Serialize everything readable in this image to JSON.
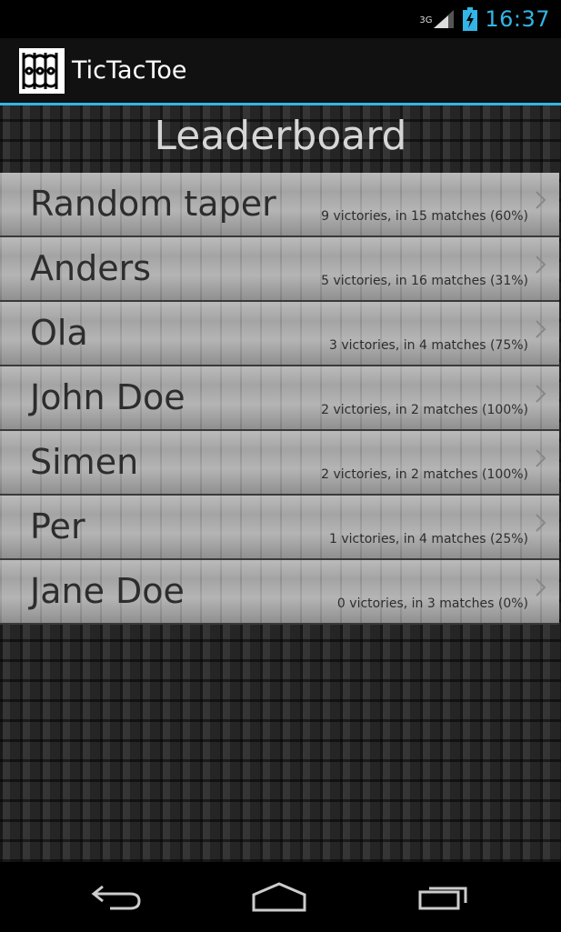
{
  "status_bar": {
    "network": "3G",
    "time": "16:37",
    "icons": [
      "signal-icon",
      "battery-charging-icon"
    ]
  },
  "action_bar": {
    "app_title": "TicTacToe",
    "app_icon": "app-logo-icon"
  },
  "screen": {
    "title": "Leaderboard"
  },
  "leaderboard": {
    "entries": [
      {
        "name": "Random taper",
        "stats": "9 victories, in 15 matches (60%)"
      },
      {
        "name": "Anders",
        "stats": "5 victories, in 16 matches (31%)"
      },
      {
        "name": "Ola",
        "stats": "3 victories, in 4 matches (75%)"
      },
      {
        "name": "John Doe",
        "stats": "2 victories, in 2 matches (100%)"
      },
      {
        "name": "Simen",
        "stats": "2 victories, in 2 matches (100%)"
      },
      {
        "name": "Per",
        "stats": "1 victories, in 4 matches (25%)"
      },
      {
        "name": "Jane Doe",
        "stats": "0 victories, in 3 matches (0%)"
      }
    ]
  },
  "nav_bar": {
    "icons": [
      "back-icon",
      "home-icon",
      "recents-icon"
    ]
  },
  "colors": {
    "accent": "#33b5e5",
    "row_background": "#a4a4a4",
    "text_dark": "#2d2d2d"
  }
}
